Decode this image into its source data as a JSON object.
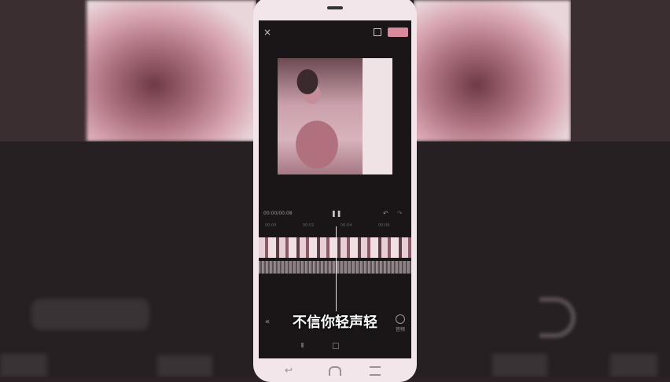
{
  "editor": {
    "close_icon": "×",
    "timecode": "00:00/00:08",
    "play_icon": "❚❚",
    "undo_icon": "↶",
    "redo_icon": "↷",
    "ruler_marks": [
      "00:00",
      "00:02",
      "00:04",
      "00:06"
    ]
  },
  "caption": {
    "text": "不信你轻声轻"
  },
  "toolbar": {
    "back_icon": "«",
    "tool_label": "音频"
  },
  "icons": [
    "close-icon",
    "fullscreen-icon",
    "pause-icon",
    "undo-icon",
    "redo-icon",
    "back-chevron-icon",
    "audio-tool-icon",
    "nav-back-icon",
    "nav-home-icon",
    "nav-menu-icon"
  ],
  "colors": {
    "accent": "#d98a9c",
    "background": "#2a2224",
    "phone_frame": "#f2e6ea"
  }
}
